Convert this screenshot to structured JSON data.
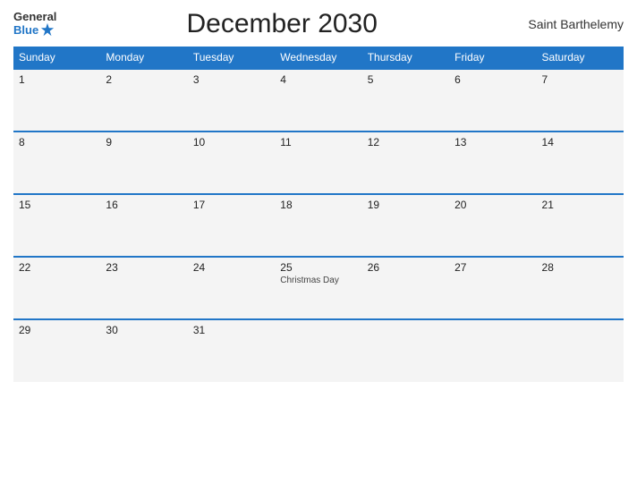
{
  "header": {
    "logo_general": "General",
    "logo_blue": "Blue",
    "title": "December 2030",
    "country": "Saint Barthelemy"
  },
  "weekdays": [
    "Sunday",
    "Monday",
    "Tuesday",
    "Wednesday",
    "Thursday",
    "Friday",
    "Saturday"
  ],
  "weeks": [
    [
      {
        "day": "1",
        "holiday": ""
      },
      {
        "day": "2",
        "holiday": ""
      },
      {
        "day": "3",
        "holiday": ""
      },
      {
        "day": "4",
        "holiday": ""
      },
      {
        "day": "5",
        "holiday": ""
      },
      {
        "day": "6",
        "holiday": ""
      },
      {
        "day": "7",
        "holiday": ""
      }
    ],
    [
      {
        "day": "8",
        "holiday": ""
      },
      {
        "day": "9",
        "holiday": ""
      },
      {
        "day": "10",
        "holiday": ""
      },
      {
        "day": "11",
        "holiday": ""
      },
      {
        "day": "12",
        "holiday": ""
      },
      {
        "day": "13",
        "holiday": ""
      },
      {
        "day": "14",
        "holiday": ""
      }
    ],
    [
      {
        "day": "15",
        "holiday": ""
      },
      {
        "day": "16",
        "holiday": ""
      },
      {
        "day": "17",
        "holiday": ""
      },
      {
        "day": "18",
        "holiday": ""
      },
      {
        "day": "19",
        "holiday": ""
      },
      {
        "day": "20",
        "holiday": ""
      },
      {
        "day": "21",
        "holiday": ""
      }
    ],
    [
      {
        "day": "22",
        "holiday": ""
      },
      {
        "day": "23",
        "holiday": ""
      },
      {
        "day": "24",
        "holiday": ""
      },
      {
        "day": "25",
        "holiday": "Christmas Day"
      },
      {
        "day": "26",
        "holiday": ""
      },
      {
        "day": "27",
        "holiday": ""
      },
      {
        "day": "28",
        "holiday": ""
      }
    ],
    [
      {
        "day": "29",
        "holiday": ""
      },
      {
        "day": "30",
        "holiday": ""
      },
      {
        "day": "31",
        "holiday": ""
      },
      {
        "day": "",
        "holiday": ""
      },
      {
        "day": "",
        "holiday": ""
      },
      {
        "day": "",
        "holiday": ""
      },
      {
        "day": "",
        "holiday": ""
      }
    ]
  ]
}
